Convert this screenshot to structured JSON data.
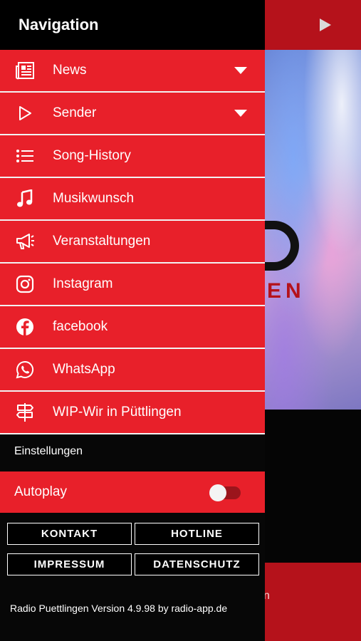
{
  "background": {
    "logo_partial": "EN",
    "bottom_partial": "n"
  },
  "drawer": {
    "title": "Navigation",
    "items": [
      {
        "label": "News",
        "icon": "newspaper-icon",
        "expandable": true
      },
      {
        "label": "Sender",
        "icon": "play-outline-icon",
        "expandable": true
      },
      {
        "label": "Song-History",
        "icon": "list-icon",
        "expandable": false
      },
      {
        "label": "Musikwunsch",
        "icon": "music-note-icon",
        "expandable": false
      },
      {
        "label": "Veranstaltungen",
        "icon": "megaphone-icon",
        "expandable": false
      },
      {
        "label": "Instagram",
        "icon": "instagram-icon",
        "expandable": false
      },
      {
        "label": "facebook",
        "icon": "facebook-icon",
        "expandable": false
      },
      {
        "label": "WhatsApp",
        "icon": "whatsapp-icon",
        "expandable": false
      },
      {
        "label": "WIP-Wir in Püttlingen",
        "icon": "signpost-icon",
        "expandable": false
      }
    ],
    "settings_title": "Einstellungen",
    "autoplay": {
      "label": "Autoplay",
      "enabled": false
    },
    "buttons": {
      "kontakt": "KONTAKT",
      "hotline": "HOTLINE",
      "impressum": "IMPRESSUM",
      "datenschutz": "DATENSCHUTZ"
    },
    "footer": "Radio Puettlingen Version 4.9.98 by radio-app.de"
  },
  "colors": {
    "accent": "#e8202a",
    "dark": "#070707"
  }
}
